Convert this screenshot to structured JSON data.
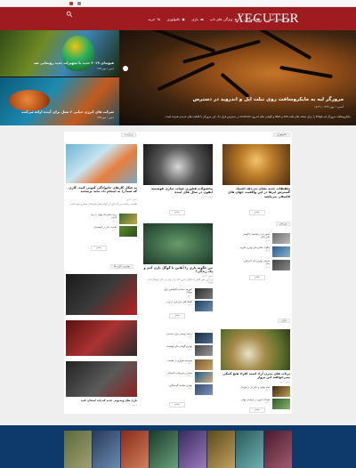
{
  "site": {
    "logo": "ECUTER",
    "logo_mark": "X"
  },
  "nav": {
    "items": [
      {
        "label": "صفحه اصلی",
        "icon": "home-icon"
      },
      {
        "label": "آموزش",
        "icon": "book-icon"
      },
      {
        "label": "ویژگی های تاپ",
        "icon": "star-icon"
      },
      {
        "label": "بازی",
        "icon": "gamepad-icon"
      },
      {
        "label": "تکنولوژی",
        "icon": "chip-icon"
      },
      {
        "label": "خرید",
        "icon": "cart-icon"
      }
    ]
  },
  "hero": {
    "main": {
      "title": "مرورگر لبه به مایکروسافت روی تبلت اپل و اندروید در دسترس",
      "meta": "ادمین ۱ مهر ۱۳۹۷ ، ۱۸:۳۹",
      "excerpt": "مایکروسافت مرورگر لبه Edge را برای نسخه های تبلت iOS و iPad و گوشی های اندروید Android در دسترس قرار داد. این مرورگر با قابلیت های جدیدی همراه است."
    },
    "side": [
      {
        "title": "هیوندای ۲۰۱۹ جدید با تجهیزات جدید رونمایی شد",
        "meta": "ادمین ۱ مهر ۱۳۹۷"
      },
      {
        "title": "شرکت های انرژی حبابی ۶ نسل برای آینده ارائه می‌کنند",
        "meta": "ادمین ۱ مهر ۱۳۹۷"
      }
    ]
  },
  "sections": {
    "tech_label": "تکنولوژی",
    "sport_label": "ورزش",
    "game_label": "بازی",
    "games_hot_label": "بهترین بازی ها",
    "trend_label": "پربازدید"
  },
  "col_right": {
    "card1": {
      "title": "تحقیقات جدید نشان می‌دهد اعتماد گسترش ابرها در این واقعیت جهان های فلسفی می‌باشد",
      "meta": "ادمین ۳ مهر",
      "text": "امروزه در دنیای مدرن، فناوری ابری و ساختمان های بلند یکی از جذاب ترین موضوعات برای تحقیقات است."
    },
    "minis": [
      {
        "title": "آیفون ۸ در مقایسه با گوشی های دیگر",
        "meta": "۵ مهر"
      },
      {
        "title": "چگونه عکس های بهتری بگیریم",
        "meta": "۵ مهر"
      },
      {
        "title": "معرفی بهترین لپ تاپ های سال",
        "meta": "۴ مهر"
      }
    ],
    "card2": {
      "title": "پرتاب های مدرن آزاد است افراد هیچ کمکی نمی‌خواهند این پرواز",
      "meta": "ادمین ۲ مهر"
    },
    "minis2": [
      {
        "title": "جام جهانی و تاثیر آن بر فوتبال",
        "meta": "۱ مهر"
      },
      {
        "title": "فوتبال امروز در سراسر جهان",
        "meta": "۱ مهر"
      }
    ]
  },
  "col_mid": {
    "card1": {
      "title": "محصولات فناوری شتاب سازی هوشمند آیفون در سال های آینده",
      "meta": "ادمین ۳ مهر"
    },
    "card2": {
      "title": "من چگونه بازی را آنلاین با گوگل بازی کنم و یک زندگی؟",
      "meta": "ادمین ۲ مهر",
      "text": "در بازی های آنلاین با دیگران بازی کنید و از بودن در کنار دوستان لذت ببرید."
    },
    "minis": [
      {
        "title": "آموزش ساخت اپلیکیشن برای موبایل",
        "meta": "۳ مهر"
      },
      {
        "title": "تکنیک های بازاریابی در وب",
        "meta": "۳ مهر"
      },
      {
        "title": "برنامه نویسی برای مبتدیان",
        "meta": "۲ مهر"
      },
      {
        "title": "بهترین گوشی های هوشمند",
        "meta": "۲ مهر"
      }
    ],
    "minis2": [
      {
        "title": "دوچرخه سواری در طبیعت",
        "meta": "۱ مهر"
      },
      {
        "title": "ساحل و تفریحات تابستانی",
        "meta": "۱ مهر"
      },
      {
        "title": "بهترین مقاصد گردشگری",
        "meta": "۱ مهر"
      }
    ]
  },
  "col_left": {
    "card1": {
      "title": "به شکل کارهای خانوادگی کنونی کنید، کاری که شما را به اینجام داد نباید برسانید",
      "meta": "ادمین ۳ مهر",
      "text": "طبیعت زیباست و رنگ های آن الهام بخش هنرمندان بسیاری بوده است."
    },
    "minis": [
      {
        "title": "پرنده هایی که جهان را زیبا کردند",
        "meta": "۳ مهر"
      },
      {
        "title": "طبیعت بکر در کوهستان",
        "meta": "۲ مهر"
      }
    ],
    "list": [
      {
        "title": "بازی های ویدیویی جدید که باید امتحان کنید",
        "meta": "۲ مهر"
      },
      {
        "title": "مرور بازی های سال و رتبه بندی آنها",
        "meta": "۲ مهر"
      },
      {
        "title": "بهترین کامپیوترهای بازی",
        "meta": "۱ مهر"
      },
      {
        "title": "جنگ ستارگان بازی جدید",
        "meta": "۱ مهر"
      }
    ]
  },
  "more_label": "بیشتر",
  "colors": {
    "brand": "#9e1b1f",
    "footer": "#0e3a6b"
  }
}
